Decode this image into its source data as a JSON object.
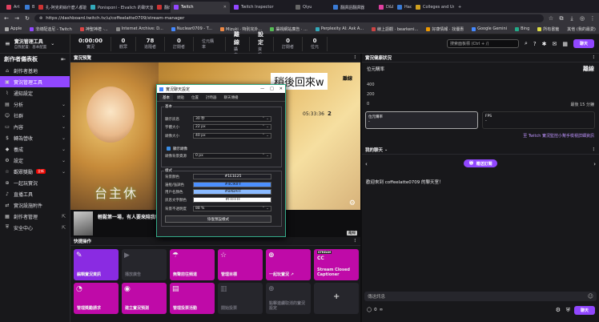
{
  "browser": {
    "tabs": [
      {
        "label": "Art",
        "color": "#e04060"
      },
      {
        "label": "Bilibili",
        "color": "#3a7bd5"
      },
      {
        "label": "扎-阿克莉絲什麼人都能不-二次元",
        "color": "#cc3333"
      },
      {
        "label": "Ponisponi - Elvalich 的聊天室",
        "color": "#3ab"
      },
      {
        "label": "翻成",
        "color": "#cc3333"
      },
      {
        "label": "Twitch",
        "color": "#9147ff",
        "active": true
      },
      {
        "label": "Twitch Inspector",
        "color": "#9147ff"
      },
      {
        "label": "Qiyu",
        "color": "#666"
      },
      {
        "label": "翻譯語翻譯器",
        "color": "#3a7bd5"
      },
      {
        "label": "D&D",
        "color": "#e040a0"
      },
      {
        "label": "Hack",
        "color": "#3a7bd5"
      },
      {
        "label": "Colleges and Univers",
        "color": "#d0a020"
      }
    ],
    "url": "https://dashboard.twitch.tv/u/coffeelatte0709/stream-manager",
    "bookmarks": [
      "Apple",
      "非總配迪尼 - Twitch",
      "神聖神禮 ·...",
      "Internet Archive: D...",
      "Nuclear0709 - T...",
      "Mizuki · 特別完外...",
      "攝視網站廣告 · ...",
      "Perplexity AI: Ask A...",
      "線上語觀 · bearkeni...",
      "好康情報 · 找優惠",
      "Google Gemini",
      "Bing",
      "所有書籤"
    ],
    "profile_label": "其他 (我的最愛)"
  },
  "topbar": {
    "app_title": "實況管理工具",
    "app_subtitle": "自我配置：基本配置",
    "stats": [
      {
        "value": "0:00:00",
        "label": "實況"
      },
      {
        "value": "0",
        "label": "觀眾"
      },
      {
        "value": "78",
        "label": "追隨者"
      },
      {
        "value": "0",
        "label": "訂閱者"
      }
    ],
    "bits_label": "位元購率",
    "raid_label": "離線",
    "raid_sub": "攝向",
    "settings_label": "設定",
    "settings_sub": "資訊",
    "zero1": "0",
    "zero1_label": "訂閱者",
    "zero2": "0",
    "zero2_label": "位元",
    "search_placeholder": "搜索面板標 (Ctrl + /)",
    "chat_button": "聊天"
  },
  "sidebar": {
    "title": "創作者儀表板",
    "items": [
      {
        "icon": "⌂",
        "label": "創作者基地"
      },
      {
        "icon": "▣",
        "label": "實況管理工具",
        "selected": true
      },
      {
        "icon": "⌇",
        "label": "通知設定"
      },
      {
        "icon": "▤",
        "label": "分析",
        "arrow": "⌄"
      },
      {
        "icon": "☺",
        "label": "社群",
        "arrow": "⌄"
      },
      {
        "icon": "▭",
        "label": "內容",
        "arrow": "⌄"
      },
      {
        "icon": "$",
        "label": "轉為營收",
        "arrow": "⌄"
      },
      {
        "icon": "◆",
        "label": "養成",
        "arrow": "⌄"
      },
      {
        "icon": "⚙",
        "label": "設定",
        "arrow": "⌄"
      },
      {
        "icon": "☆",
        "label": "觀眾獎勵",
        "badge": "全新",
        "arrow": "⌄"
      },
      {
        "icon": "⊕",
        "label": "一起玩實況"
      },
      {
        "icon": "♪",
        "label": "直播工具"
      },
      {
        "icon": "⇄",
        "label": "實況設施附件"
      },
      {
        "icon": "▦",
        "label": "創作者管理",
        "ext": "⇱"
      },
      {
        "icon": "⛨",
        "label": "安全中心",
        "ext": "⇱"
      }
    ]
  },
  "preview": {
    "header": "實況預覽",
    "title_overlay": "稍後回來w",
    "live_badge": "離線",
    "lower_banner": "台主休",
    "timer": "05:33:36",
    "timer_count": "2",
    "video_title": "輕鬆第一場，有人要來陪我嗎?",
    "tag": "離線"
  },
  "dialog": {
    "title": "實況聊天設定",
    "win_buttons": [
      "—",
      "□",
      "✕"
    ],
    "tabs": [
      "基本",
      "頭貼",
      "位置",
      "計時器",
      "聊天傳播"
    ],
    "group1_title": "基本",
    "fields": [
      {
        "label": "顯示訊息",
        "value": "30 秒"
      },
      {
        "label": "字體大小",
        "value": "22 px"
      },
      {
        "label": "頭像大小",
        "value": "40 px"
      },
      {
        "label": "頭像彈出",
        "value": ""
      },
      {
        "label": "頭像背景資源",
        "value": "0 px"
      }
    ],
    "checkbox_label": "顯示頭像",
    "group2_title": "樣式",
    "colors": [
      {
        "label": "背景顏色",
        "value": "#1E1E25",
        "swatch": "#1E1E25"
      },
      {
        "label": "邊框/強調色",
        "value": "#4C90FF",
        "swatch": "#4C90FF"
      },
      {
        "label": "用戶名顏色",
        "value": "#8ABAFF",
        "swatch": "#8ABAFF"
      },
      {
        "label": "訊息文字顏色",
        "value": "#FFFFFF",
        "swatch": "#FFFFFF"
      }
    ],
    "opacity_label": "背景不透明度",
    "opacity_value": "88 %",
    "reset_button": "恢復預設樣式"
  },
  "quick": {
    "header": "快捷操作",
    "tiles": [
      {
        "label": "編輯實況資訊",
        "icon": "✎",
        "style": "purple"
      },
      {
        "label": "播放廣告",
        "icon": "▶",
        "style": "dis"
      },
      {
        "label": "無聲前往頻道",
        "icon": "☂",
        "style": "pink"
      },
      {
        "label": "管理目標",
        "icon": "☆",
        "style": "pink"
      },
      {
        "label": "一起玩實況 ↗",
        "icon": "⊕",
        "style": "pink"
      },
      {
        "label": "Stream Closed Captioner",
        "icon": "CC",
        "style": "pink",
        "badge": "STREAM"
      },
      {
        "label": "管理獎勵請求",
        "icon": "◔",
        "style": "pink"
      },
      {
        "label": "建立實況預測",
        "icon": "◉",
        "style": "pink"
      },
      {
        "label": "管理投票活動",
        "icon": "▤",
        "style": "pink"
      },
      {
        "label": "開始投票",
        "icon": "▥",
        "style": "dis"
      },
      {
        "label": "點擊連續取消的實況設定",
        "icon": "⊕",
        "style": "dis"
      },
      {
        "label": "",
        "icon": "+",
        "style": "add"
      }
    ]
  },
  "health": {
    "header": "實況健康狀況",
    "metric_label": "位元購率",
    "offline": "離線",
    "y_ticks": [
      "400",
      "200",
      "0"
    ],
    "since_label": "最後 15 分鐘",
    "box1_label": "位元購率",
    "box1_value": "-",
    "box2_label": "FPS",
    "box2_value": "-",
    "link": "至 Twitch 實況監控小幫手檢視詳細資訊"
  },
  "chat": {
    "header": "我的聊天",
    "sub_button": "贈送訂閱",
    "welcome": "歡迎來到 coffeelatte0709 的聊天室！",
    "input_placeholder": "傳送訊息",
    "points": "0",
    "send": "聊天"
  }
}
